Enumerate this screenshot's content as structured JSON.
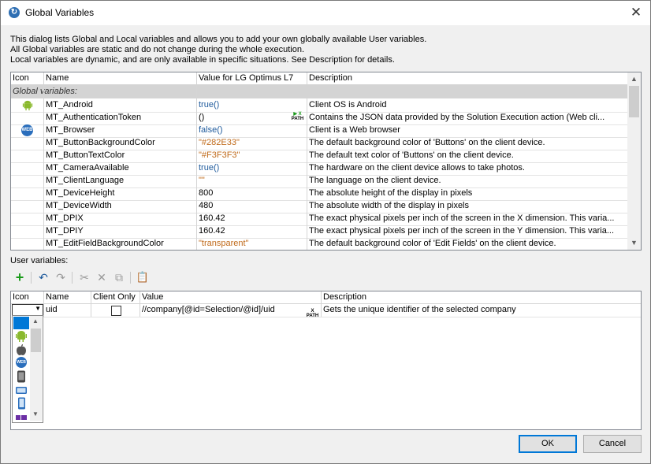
{
  "window": {
    "title": "Global Variables",
    "close_glyph": "✕"
  },
  "intro": {
    "line1": "This dialog lists Global and Local variables and allows you to add your own globally available User variables.",
    "line2": "All Global variables are static and do not change during the whole execution.",
    "line3": "Local variables are dynamic, and are only available in specific situations. See Description for details."
  },
  "global_table": {
    "headers": {
      "icon": "Icon",
      "name": "Name",
      "value": "Value for LG Optimus L7",
      "description": "Description"
    },
    "group_label": "Global variables:",
    "rows": [
      {
        "icon": "android-icon",
        "name": "MT_Android",
        "value": "true()",
        "value_kind": "fn",
        "description": "Client OS is Android",
        "xpath": false
      },
      {
        "icon": "",
        "name": "MT_AuthenticationToken",
        "value": "()",
        "value_kind": "plain",
        "description": "Contains the JSON data provided by the Solution Execution action (Web cli...",
        "xpath": true
      },
      {
        "icon": "web-icon",
        "name": "MT_Browser",
        "value": "false()",
        "value_kind": "fn",
        "description": "Client is a Web browser",
        "xpath": false
      },
      {
        "icon": "",
        "name": "MT_ButtonBackgroundColor",
        "value": "\"#282E33\"",
        "value_kind": "str",
        "description": "The default background color of 'Buttons' on the client device.",
        "xpath": false
      },
      {
        "icon": "",
        "name": "MT_ButtonTextColor",
        "value": "\"#F3F3F3\"",
        "value_kind": "str",
        "description": "The default text color of 'Buttons' on the client device.",
        "xpath": false
      },
      {
        "icon": "",
        "name": "MT_CameraAvailable",
        "value": "true()",
        "value_kind": "fn",
        "description": "The hardware on the client device allows to take photos.",
        "xpath": false
      },
      {
        "icon": "",
        "name": "MT_ClientLanguage",
        "value": "\"\"",
        "value_kind": "str",
        "description": "The language on the client device.",
        "xpath": false
      },
      {
        "icon": "",
        "name": "MT_DeviceHeight",
        "value": "800",
        "value_kind": "plain",
        "description": "The absolute height of the display in pixels",
        "xpath": false
      },
      {
        "icon": "",
        "name": "MT_DeviceWidth",
        "value": "480",
        "value_kind": "plain",
        "description": "The absolute width of the display in pixels",
        "xpath": false
      },
      {
        "icon": "",
        "name": "MT_DPIX",
        "value": "160.42",
        "value_kind": "plain",
        "description": "The exact physical pixels per inch of the screen in the X dimension. This varia...",
        "xpath": false
      },
      {
        "icon": "",
        "name": "MT_DPIY",
        "value": "160.42",
        "value_kind": "plain",
        "description": "The exact physical pixels per inch of the screen in the Y dimension. This varia...",
        "xpath": false
      },
      {
        "icon": "",
        "name": "MT_EditFieldBackgroundColor",
        "value": "\"transparent\"",
        "value_kind": "str",
        "description": "The default background color of 'Edit Fields' on the client device.",
        "xpath": false
      }
    ]
  },
  "user_section": {
    "label": "User variables:"
  },
  "toolbar": {
    "add": "+",
    "undo": "↶",
    "redo": "↷",
    "cut": "✂",
    "delete": "✕",
    "copy": "⧉",
    "paste": "📋"
  },
  "user_table": {
    "headers": {
      "icon": "Icon",
      "name": "Name",
      "client_only": "Client Only",
      "value": "Value",
      "description": "Description"
    },
    "rows": [
      {
        "name": "uid",
        "client_only": false,
        "value": "//company[@id=Selection/@id]/uid",
        "description": "Gets the unique identifier of the selected company"
      }
    ]
  },
  "icon_list": [
    "blank",
    "android-icon",
    "apple-icon",
    "web-icon",
    "phone-icon",
    "tablet-rotate-icon",
    "phone-rotate-icon",
    "windows-icon"
  ],
  "buttons": {
    "ok": "OK",
    "cancel": "Cancel"
  },
  "xpath_label": {
    "top": "X",
    "bottom": "PATH"
  },
  "colors": {
    "fn": "#1e5a9c",
    "str": "#c06a1a",
    "accent": "#0078d7",
    "android": "#8ab92d"
  }
}
